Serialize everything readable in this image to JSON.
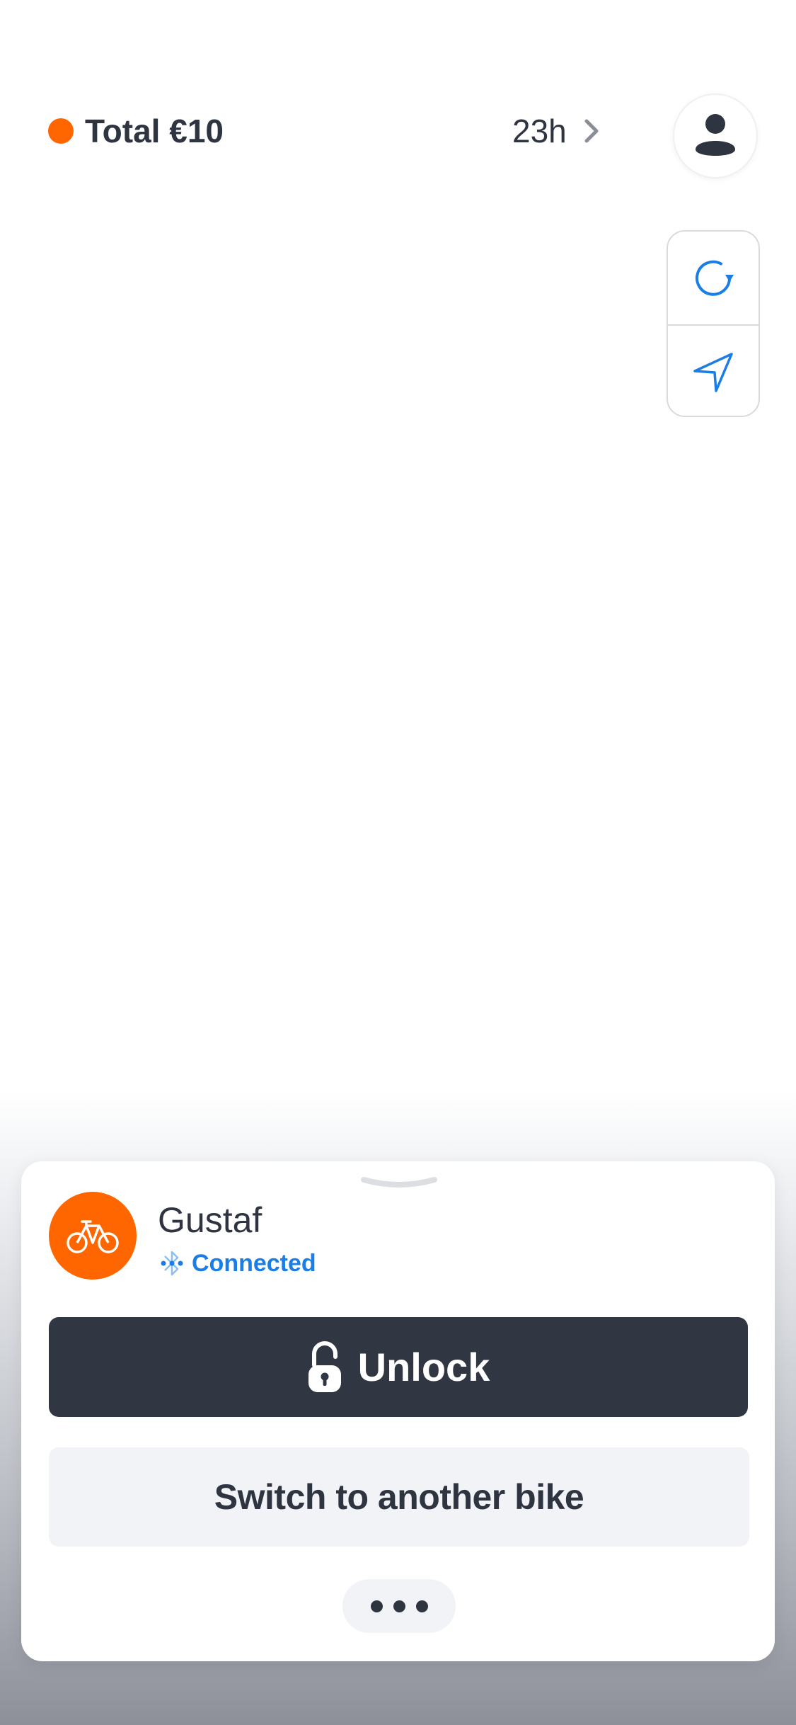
{
  "header": {
    "total_label": "Total €10",
    "timer": "23h"
  },
  "bike": {
    "name": "Gustaf",
    "status": "Connected"
  },
  "actions": {
    "unlock_label": "Unlock",
    "switch_label": "Switch to another bike"
  },
  "icons": {
    "status_dot": "status-dot",
    "chevron": "chevron-right-icon",
    "profile": "profile-icon",
    "refresh": "refresh-icon",
    "locate": "navigation-arrow-icon",
    "bike": "bicycle-icon",
    "bluetooth": "bluetooth-icon",
    "lock": "unlocked-padlock-icon",
    "more": "more-dots-icon"
  },
  "colors": {
    "accent_orange": "#ff6600",
    "link_blue": "#1a7ee6",
    "dark_button": "#313643",
    "text_dark": "#2f3441",
    "light_button": "#f1f3f6"
  }
}
